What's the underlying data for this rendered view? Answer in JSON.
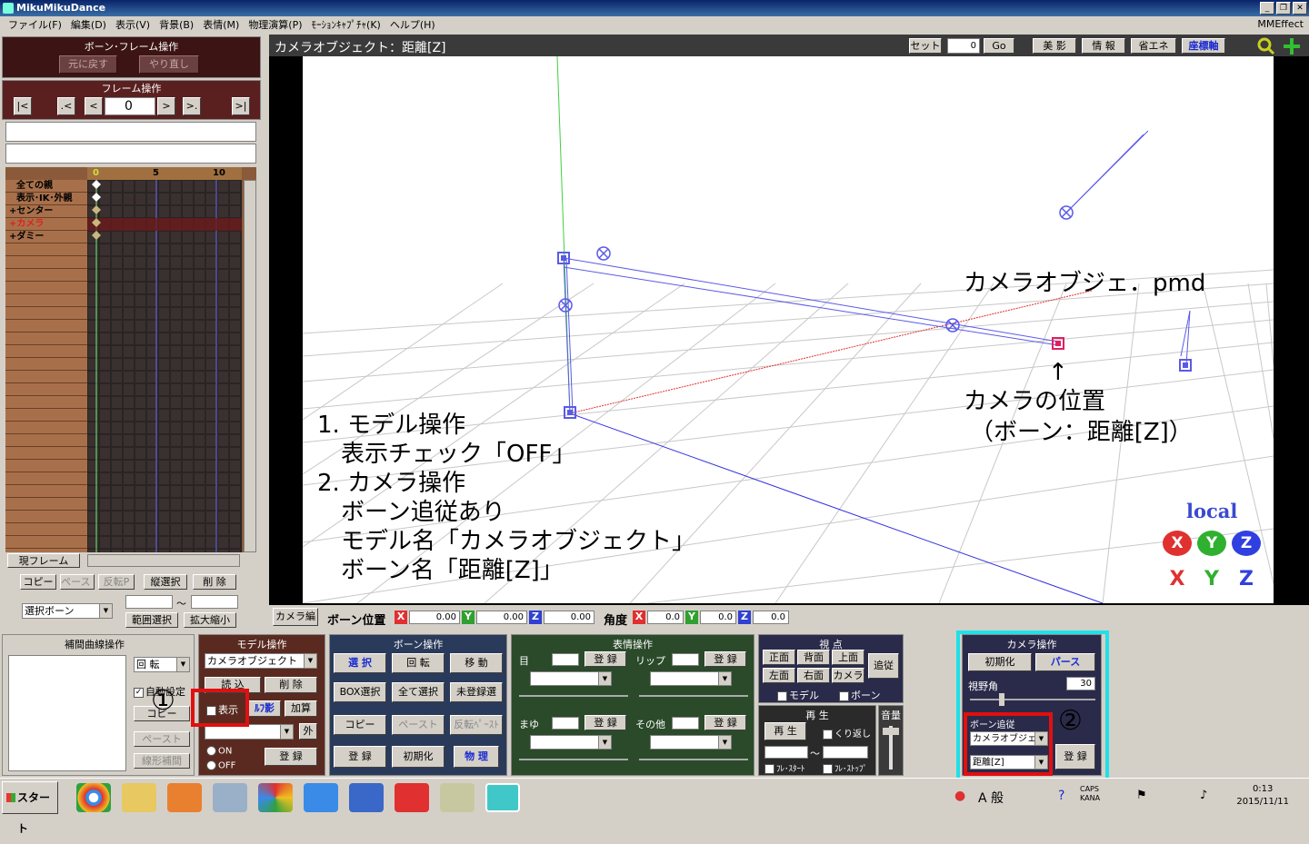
{
  "window": {
    "title": "MikuMikuDance"
  },
  "menu": [
    "ファイル(F)",
    "編集(D)",
    "表示(V)",
    "背景(B)",
    "表情(M)",
    "物理演算(P)",
    "ﾓｰｼｮﾝｷｬﾌﾟﾁｬ(K)",
    "ヘルプ(H)"
  ],
  "mmeffect": "MMEffect",
  "bone_frame": {
    "title": "ボーン･フレーム操作",
    "undo": "元に戻す",
    "redo": "やり直し"
  },
  "frame_ops": {
    "title": "フレーム操作",
    "frame_value": "0",
    "btn_first": "|<",
    "btn_prevkey": ".<",
    "btn_prev": "<",
    "btn_next": ">",
    "btn_nextkey": ">.",
    "btn_last": ">|"
  },
  "timeline": {
    "ticks": [
      "0",
      "5",
      "10"
    ],
    "rows": [
      "全ての親",
      "表示･IK･外親",
      "+センター",
      "+カメラ",
      "+ダミー"
    ]
  },
  "left_bottom": {
    "current_frame": "現フレーム",
    "copy": "コピー",
    "paste": "ペースト",
    "reverse": "反転P",
    "vselect": "縦選択",
    "delete": "削 除",
    "select_bone": "選択ボーン",
    "tilde": "～",
    "range_select": "範囲選択",
    "scale": "拡大縮小"
  },
  "viewport": {
    "title": "カメラオブジェクト：距離[Z]",
    "set": "セット",
    "frame": "0",
    "go": "Go",
    "bieffect": "美 影",
    "info": "情 報",
    "eco": "省エネ",
    "axis": "座標軸",
    "annotation_file": "カメラオブジェ．pmd",
    "arrow": "↑",
    "annotation_pos1": "カメラの位置",
    "annotation_pos2": "（ボーン：距離[Z]）",
    "steps": [
      "1. モデル操作",
      "　表示チェック「OFF」",
      "2. カメラ操作",
      "　ボーン追従あり",
      "　モデル名「カメラオブジェクト」",
      "　ボーン名「距離[Z]」"
    ],
    "local": "local",
    "axis_labels": [
      "X",
      "Y",
      "Z",
      "X",
      "Y",
      "Z"
    ]
  },
  "bone_pos_bar": {
    "camera_edit": "カメラ編",
    "bone_pos_label": "ボーン位置",
    "x": "0.00",
    "y": "0.00",
    "z": "0.00",
    "angle_label": "角度",
    "ax": "0.0",
    "ay": "0.0",
    "az": "0.0",
    "lx": "X",
    "ly": "Y",
    "lz": "Z"
  },
  "interp": {
    "title": "補間曲線操作",
    "rotate": "回 転",
    "auto": "自動設定",
    "copy": "コピー",
    "paste": "ペースト",
    "linear": "線形補間"
  },
  "model_ops": {
    "title": "モデル操作",
    "model": "カメラオブジェクト",
    "load": "読 込",
    "delete": "削 除",
    "show": "表示",
    "self_shadow": "ﾙﾌ影",
    "add": "加算",
    "outer": "外",
    "on": "ON",
    "off": "OFF",
    "register": "登 録",
    "marker": "①"
  },
  "bone_ops": {
    "title": "ボーン操作",
    "select": "選 択",
    "rotate": "回 転",
    "move": "移 動",
    "box": "BOX選択",
    "all": "全て選択",
    "unreg": "未登録選",
    "copy": "コピー",
    "paste": "ペースト",
    "rev": "反転ﾍﾟｰｽﾄ",
    "register": "登 録",
    "init": "初期化",
    "physics": "物 理"
  },
  "face_ops": {
    "title": "表情操作",
    "eye": "目",
    "lip": "リップ",
    "brow": "まゆ",
    "other": "その他",
    "register": "登 録"
  },
  "view": {
    "title": "視 点",
    "front": "正面",
    "back": "背面",
    "top": "上面",
    "follow": "追従",
    "left": "左面",
    "right": "右面",
    "camera": "カメラ",
    "model": "モデル",
    "bone": "ボーン"
  },
  "play": {
    "title": "再 生",
    "play": "再 生",
    "repeat": "くり返し",
    "tilde": "～",
    "fstart": "ﾌﾚ･ｽﾀｰﾄ",
    "fstop": "ﾌﾚ･ｽﾄｯﾌﾟ",
    "volume": "音量"
  },
  "camera_ops": {
    "title": "カメラ操作",
    "init": "初期化",
    "perspective": "パース",
    "fov_label": "視野角",
    "fov": "30",
    "bone_follow": "ボーン追従",
    "model": "カメラオブジェ",
    "bone": "距離[Z]",
    "register": "登 録",
    "marker": "②"
  },
  "taskbar": {
    "start": "スタート",
    "ime": "A 般",
    "caps": "CAPS",
    "kana": "KANA",
    "time": "0:13",
    "date": "2015/11/11"
  },
  "colors": {
    "accent_red": "#e01010",
    "accent_cyan": "#20e0e8",
    "viewport_bg": "#ffffff"
  }
}
